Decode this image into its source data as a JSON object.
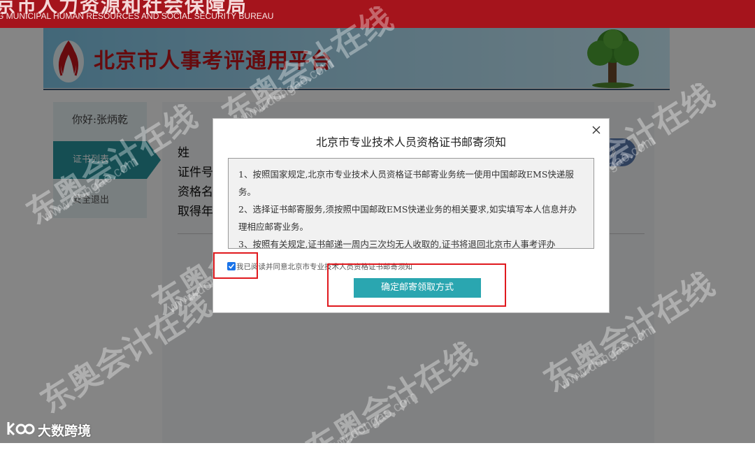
{
  "header": {
    "bureau_name_cn": "京市人力资源和社会保障局",
    "bureau_name_en": "G MUNICIPAL HUMAN RESOURCES AND SOCIAL SECURITY BUREAU",
    "platform_title": "北京市人事考评通用平台"
  },
  "sidebar": {
    "greeting": "你好:张炳乾",
    "items": [
      {
        "label": "证书列表",
        "active": true
      },
      {
        "label": "安全退出",
        "active": false
      }
    ]
  },
  "main": {
    "labels": [
      "姓",
      "证件号",
      "资格名",
      "取得年"
    ],
    "pill_button": "》"
  },
  "modal": {
    "title": "北京市专业技术人员资格证书邮寄须知",
    "notices": [
      "1、按照国家规定,北京市专业技术人员资格证书邮寄业务统一使用中国邮政EMS快递服务。",
      "2、选择证书邮寄服务,须按照中国邮政EMS快递业务的相关要求,如实填写本人信息并办理相应邮寄业务。",
      "3、按照有关规定,证书邮递一周内三次均无人收取的,证书将退回北京市人事考评办"
    ],
    "agree_checked": true,
    "agree_label": "我已阅读并同意北京市专业技术人员资格证书邮寄须知",
    "confirm_label": "确定邮寄领取方式"
  },
  "watermark": {
    "text": "东奥会计在线",
    "url": "www.dongao.com"
  },
  "footer": {
    "brand": "大数跨境"
  },
  "colors": {
    "header_red": "#a5141c",
    "accent_teal": "#2aa6b0",
    "highlight_red": "#e0191e"
  }
}
